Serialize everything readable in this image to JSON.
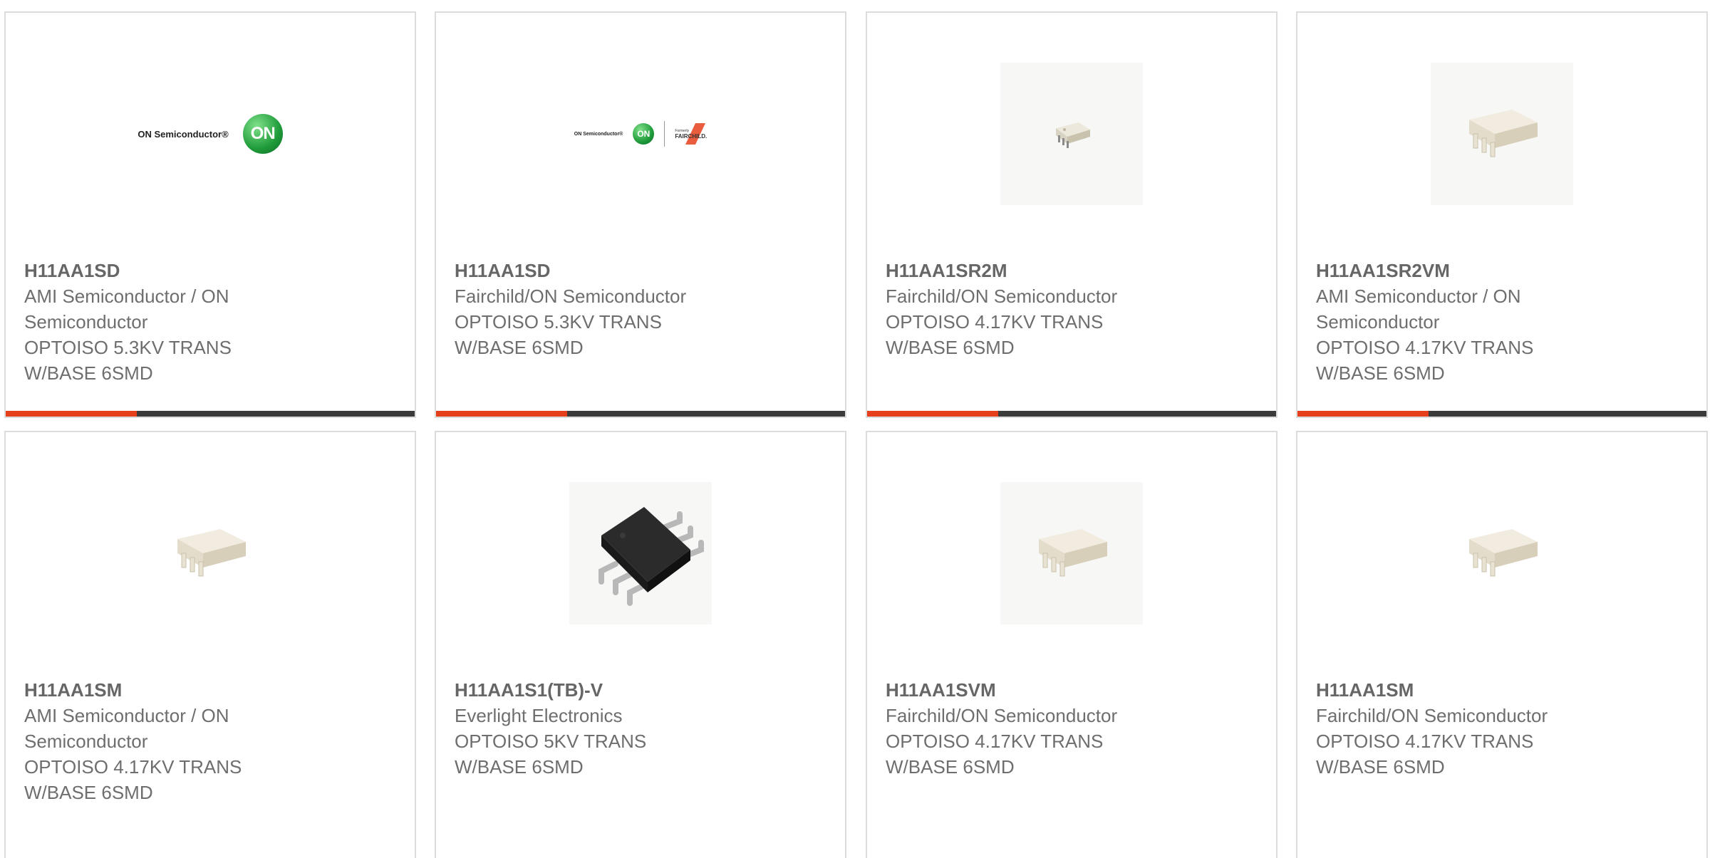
{
  "products": [
    {
      "part": "H11AA1SD",
      "maker": "AMI Semiconductor / ON Semiconductor",
      "desc": "OPTOISO 5.3KV TRANS W/BASE 6SMD",
      "image": "on-semiconductor-logo"
    },
    {
      "part": "H11AA1SD",
      "maker": "Fairchild/ON Semiconductor",
      "desc": "OPTOISO 5.3KV TRANS W/BASE 6SMD",
      "image": "on-fairchild-logo"
    },
    {
      "part": "H11AA1SR2M",
      "maker": "Fairchild/ON Semiconductor",
      "desc": "OPTOISO 4.17KV TRANS W/BASE 6SMD",
      "image": "chip-small-photo"
    },
    {
      "part": "H11AA1SR2VM",
      "maker": "AMI Semiconductor / ON Semiconductor",
      "desc": "OPTOISO 4.17KV TRANS W/BASE 6SMD",
      "image": "chip-white-photo"
    },
    {
      "part": "H11AA1SM",
      "maker": "AMI Semiconductor / ON Semiconductor",
      "desc": "OPTOISO 4.17KV TRANS W/BASE 6SMD",
      "image": "chip-white-photo"
    },
    {
      "part": "H11AA1S1(TB)-V",
      "maker": "Everlight Electronics",
      "desc": "OPTOISO 5KV TRANS W/BASE 6SMD",
      "image": "chip-black-photo"
    },
    {
      "part": "H11AA1SVM",
      "maker": "Fairchild/ON Semiconductor",
      "desc": "OPTOISO 4.17KV TRANS W/BASE 6SMD",
      "image": "chip-white-photo"
    },
    {
      "part": "H11AA1SM",
      "maker": "Fairchild/ON Semiconductor",
      "desc": "OPTOISO 4.17KV TRANS W/BASE 6SMD",
      "image": "chip-white-photo"
    }
  ],
  "logos": {
    "on_text": "ON Semiconductor®",
    "on_mark": "ON",
    "formerly": "Formerly",
    "fairchild": "FAIRCHILD."
  },
  "colors": {
    "accent": "#e5401b",
    "bar": "#3b3b3b",
    "text": "#6e6e6e",
    "border": "#dcdcdc"
  }
}
